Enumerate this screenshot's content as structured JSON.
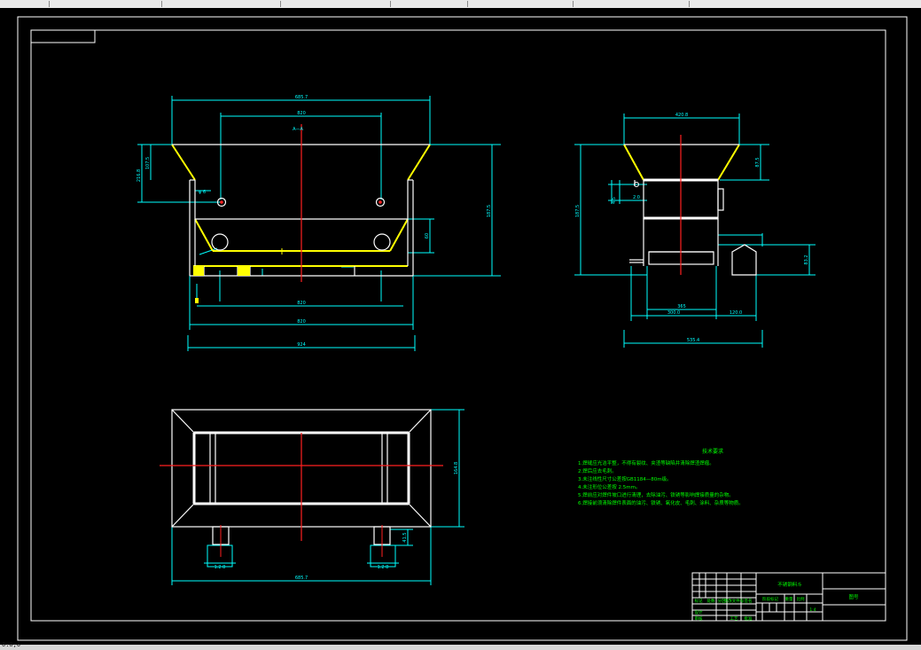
{
  "dimensions": {
    "front_top_width": "685.7",
    "front_hole_spacing": "820",
    "front_center_label": "A—A",
    "front_left_dim_outer": "216.8",
    "front_left_dim_inner": "107.5",
    "front_right_height": "187.5",
    "front_inner_height": "60",
    "front_hole_label": "φ 6",
    "front_bottom_inner": "820",
    "front_bottom_mid": "820",
    "front_bottom_total": "924",
    "side_top_width": "420.8",
    "side_right_dim": "87.5",
    "side_left_height": "187.5",
    "side_small_a": "4.5",
    "side_small_b": "2.0",
    "side_outlet_dim": "83.2",
    "side_bottom_inner": "365",
    "side_bottom_a": "300.0",
    "side_bottom_b": "120.0",
    "side_bottom_total": "535.4",
    "plan_right_dim": "164.8",
    "plan_leg_dim": "41.5",
    "plan_leg_w1": "1.2 8",
    "plan_leg_w2": "1.2 8",
    "plan_bottom_total": "685.7"
  },
  "notes": {
    "title": "技术要求",
    "items": [
      "1.焊缝应光洁平整，不得有裂纹、夹渣等缺陷并清除焊渣焊瘤。",
      "2.焊后应去毛刺。",
      "3.未注线性尺寸公差按GB1184—80m级。",
      "4.未注形位公差按 2.5mm。",
      "5.焊前应对焊件坡口进行清理，去除油污、铁锈等影响焊接质量的杂物。",
      "6.焊接前须清除焊件表面的油污、铁锈、氧化皮、毛刺、涂料、杂质等物质。"
    ]
  },
  "title_block": {
    "part_name": "不锈钢料斗",
    "drawing_no": "图号",
    "scale": "1:4",
    "row_labels": [
      "标记",
      "处数",
      "分区",
      "更改文件号",
      "签名",
      "年月日"
    ],
    "sign_labels": [
      "设计",
      "审核",
      "工艺",
      "批准"
    ],
    "stage_labels": [
      "阶段标记",
      "重量",
      "比例"
    ]
  },
  "status": {
    "coordinate": "0.0,0"
  },
  "colors": {
    "background": "#000000",
    "frame": "#ffffff",
    "dimension": "#00ffff",
    "centerline": "#ff2020",
    "hopper": "#ffff00",
    "text": "#00ff00"
  }
}
